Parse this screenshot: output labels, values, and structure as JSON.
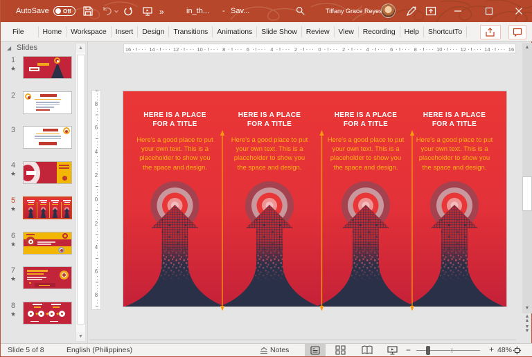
{
  "titlebar": {
    "autosave_label": "AutoSave",
    "autosave_state": "Off",
    "doc_title": "in_th...",
    "doc_separator": "-",
    "doc_status": "Sav...",
    "user_name": "Tiffany Grace Reyes",
    "more_commands": "»"
  },
  "tabs": [
    "File",
    "Home",
    "Workspace",
    "Insert",
    "Design",
    "Transitions",
    "Animations",
    "Slide Show",
    "Review",
    "View",
    "Recording",
    "Help",
    "ShortcutTo"
  ],
  "slides_panel": {
    "header": "Slides",
    "slides": [
      {
        "num": "1",
        "starred": true
      },
      {
        "num": "2",
        "starred": false
      },
      {
        "num": "3",
        "starred": false
      },
      {
        "num": "4",
        "starred": true
      },
      {
        "num": "5",
        "starred": true,
        "selected": true
      },
      {
        "num": "6",
        "starred": true
      },
      {
        "num": "7",
        "starred": true
      },
      {
        "num": "8",
        "starred": true
      }
    ],
    "star_glyph": "★"
  },
  "rulers": {
    "h": [
      "16",
      "14",
      "12",
      "10",
      "8",
      "6",
      "4",
      "2",
      "0",
      "2",
      "4",
      "6",
      "8",
      "10",
      "12",
      "14",
      "16"
    ],
    "v": [
      "8",
      "6",
      "4",
      "2",
      "0",
      "2",
      "4",
      "6",
      "8"
    ]
  },
  "slide": {
    "columns": [
      {
        "title_line1": "HERE IS A PLACE",
        "title_line2": "FOR A TITLE",
        "body_lines": [
          "Here's a good place to put",
          "your own text. This is a",
          "placeholder to show you",
          "the space and design."
        ]
      },
      {
        "title_line1": "HERE IS A PLACE",
        "title_line2": "FOR A TITLE",
        "body_lines": [
          "Here's a good place to put",
          "your own text. This is a",
          "placeholder to show you",
          "the space and design."
        ]
      },
      {
        "title_line1": "HERE IS A PLACE",
        "title_line2": "FOR A TITLE",
        "body_lines": [
          "Here's a good place to put",
          "your own text. This is a",
          "placeholder to show you",
          "the space and design."
        ]
      },
      {
        "title_line1": "HERE IS A PLACE",
        "title_line2": "FOR A TITLE",
        "body_lines": [
          "Here's a good place to put",
          "your own text. This is a",
          "placeholder to show you",
          "the space and design."
        ]
      }
    ]
  },
  "statusbar": {
    "slide_indicator": "Slide 5 of 8",
    "language": "English (Philippines)",
    "notes_label": "Notes",
    "zoom_level": "48%",
    "zoom_minus": "−",
    "zoom_plus": "+"
  },
  "colors": {
    "titlebar_bg": "#b6472a",
    "slide_red_top": "#ea3636",
    "slide_red_bottom": "#c22038",
    "arrow_navy": "#2b3049",
    "divider_yellow": "#f8990e",
    "body_text_yellow": "#fdb414",
    "accent_red": "#c43e1c"
  }
}
